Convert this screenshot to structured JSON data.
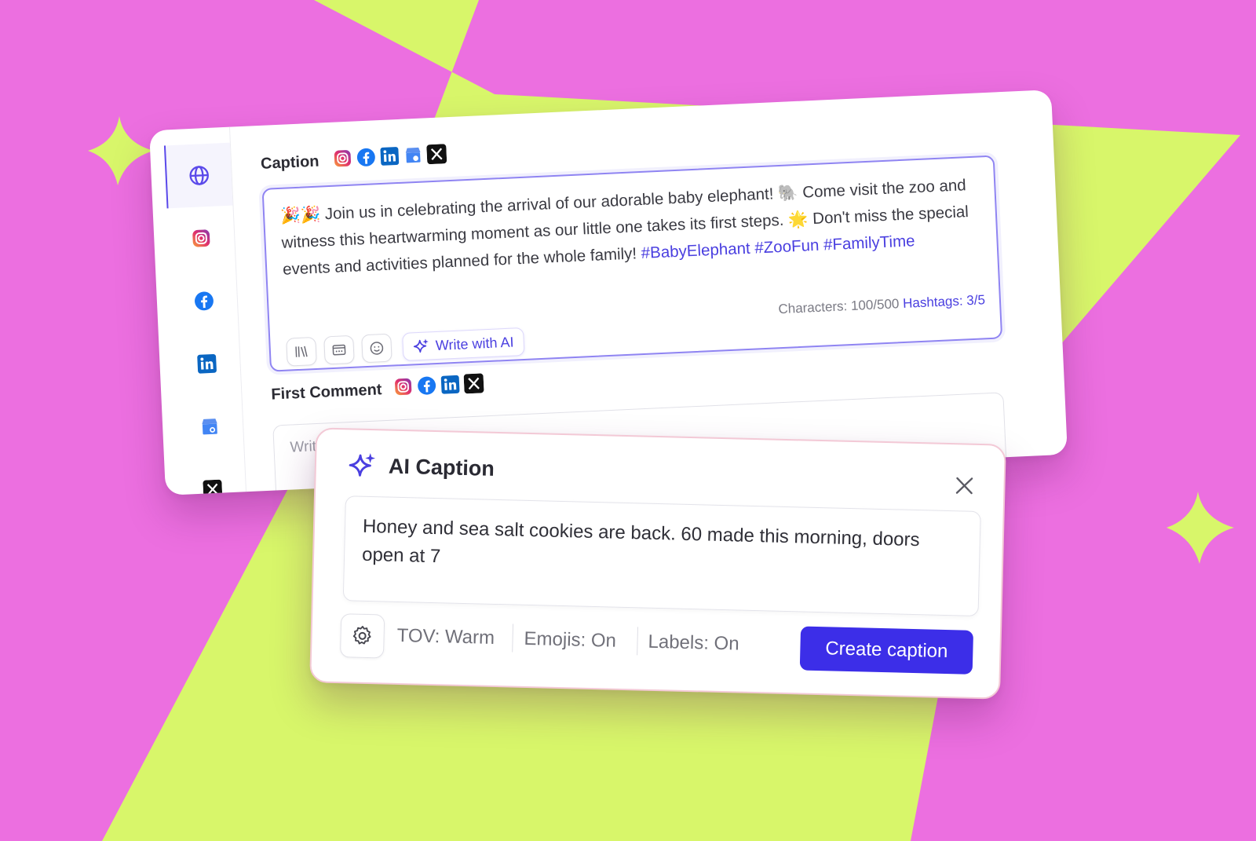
{
  "colors": {
    "background": "#ec6fe0",
    "star": "#d8f66a",
    "accent": "#3c2ee8",
    "hashtag": "#4a3fe0"
  },
  "sidebar": {
    "items": [
      {
        "name": "globe-icon",
        "active": true
      },
      {
        "name": "instagram-icon"
      },
      {
        "name": "facebook-icon"
      },
      {
        "name": "linkedin-icon"
      },
      {
        "name": "google-business-icon"
      },
      {
        "name": "x-icon"
      }
    ]
  },
  "caption": {
    "label": "Caption",
    "networks": [
      "instagram-icon",
      "facebook-icon",
      "linkedin-icon",
      "google-business-icon",
      "x-icon"
    ],
    "text_emoji_lead": "🎉🎉",
    "text_part1": "Join us in celebrating the arrival of our adorable baby elephant!",
    "text_emoji_mid": "🐘",
    "text_part2": "Come visit the zoo and witness this heartwarming moment as our little one takes its first steps.",
    "text_emoji_star": "🌟",
    "text_part3": "Don't miss the special events and activities planned for the whole family!",
    "hashtags": [
      "#BabyElephant",
      "#ZooFun",
      "#FamilyTime"
    ],
    "characters": "Characters: 100/500",
    "hashtag_count": "Hashtags: 3/5",
    "tools": [
      "library-icon",
      "media-icon",
      "emoji-icon"
    ],
    "write_ai_label": "Write with AI"
  },
  "first_comment": {
    "label": "First Comment",
    "networks": [
      "instagram-icon",
      "facebook-icon",
      "linkedin-icon",
      "x-icon"
    ],
    "placeholder": "Write your first comment..."
  },
  "ai_caption": {
    "title": "AI Caption",
    "prompt": "Honey and sea salt cookies are back. 60 made this morning, doors open at 7",
    "tov": "TOV: Warm",
    "emojis": "Emojis: On",
    "labels": "Labels: On",
    "create_label": "Create caption"
  }
}
